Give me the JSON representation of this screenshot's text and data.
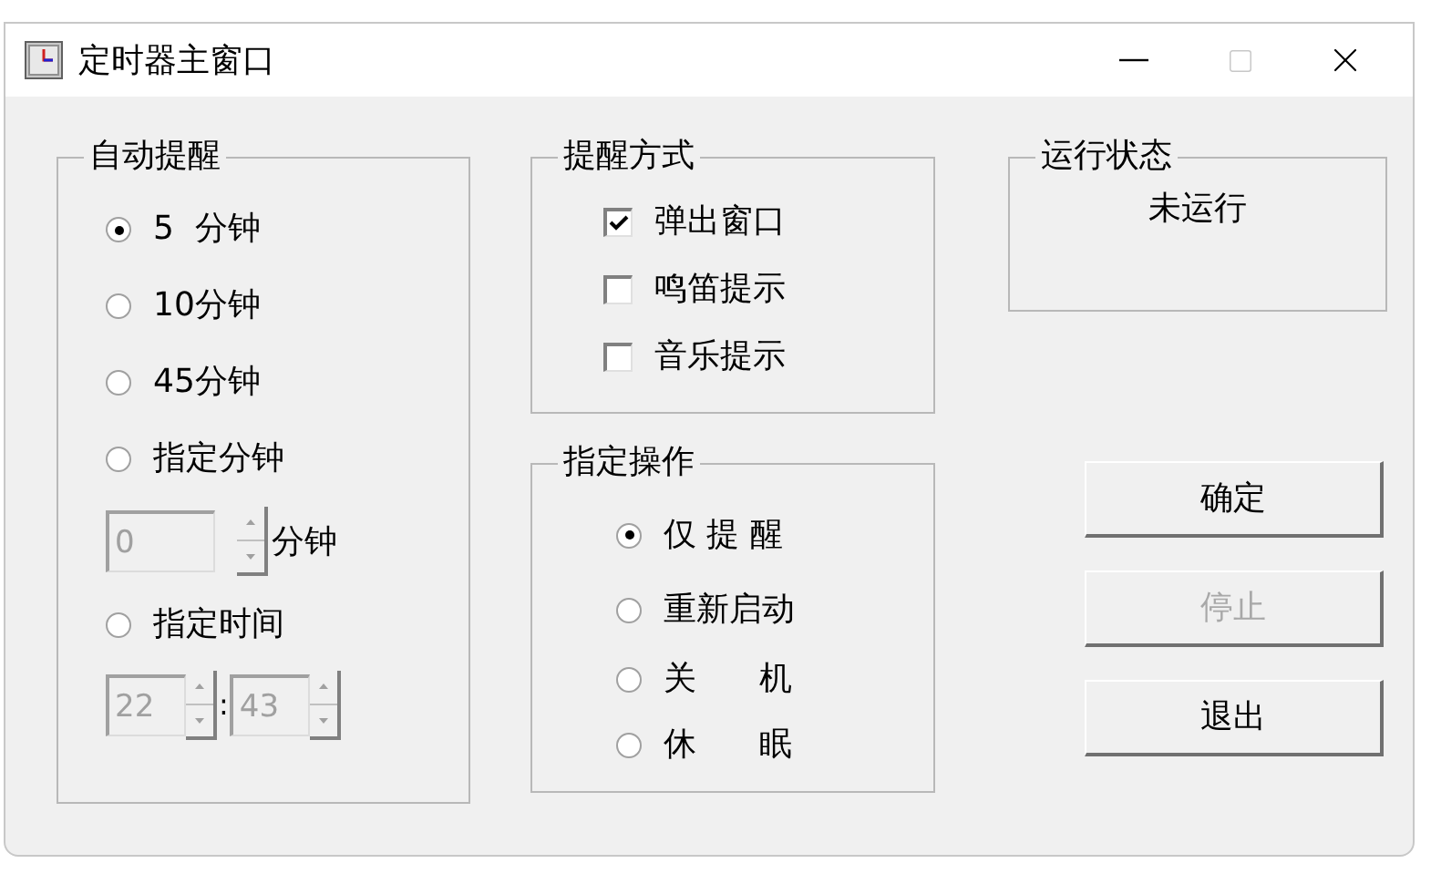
{
  "window": {
    "title": "定时器主窗口",
    "maximize_disabled": true
  },
  "auto_remind": {
    "title": "自动提醒",
    "options": [
      {
        "label": "5  分钟",
        "selected": true
      },
      {
        "label": "10分钟",
        "selected": false
      },
      {
        "label": "45分钟",
        "selected": false
      },
      {
        "label": "指定分钟",
        "selected": false
      },
      {
        "label": "指定时间",
        "selected": false
      }
    ],
    "minutes_field": {
      "value": "0",
      "disabled": true,
      "unit": "分钟"
    },
    "time_field": {
      "hour": "22",
      "minute": "43",
      "separator": ":",
      "disabled": true
    }
  },
  "remind_method": {
    "title": "提醒方式",
    "options": [
      {
        "label": "弹出窗口",
        "checked": true
      },
      {
        "label": "鸣笛提示",
        "checked": false
      },
      {
        "label": "音乐提示",
        "checked": false
      }
    ]
  },
  "action": {
    "title": "指定操作",
    "options": [
      {
        "label": "仅 提 醒",
        "selected": true
      },
      {
        "label": "重新启动",
        "selected": false
      },
      {
        "label": "关      机",
        "selected": false
      },
      {
        "label": "休      眠",
        "selected": false
      }
    ]
  },
  "run_status": {
    "title": "运行状态",
    "value": "未运行"
  },
  "buttons": [
    {
      "label": "确定",
      "disabled": false
    },
    {
      "label": "停止",
      "disabled": true
    },
    {
      "label": "退出",
      "disabled": false
    }
  ]
}
